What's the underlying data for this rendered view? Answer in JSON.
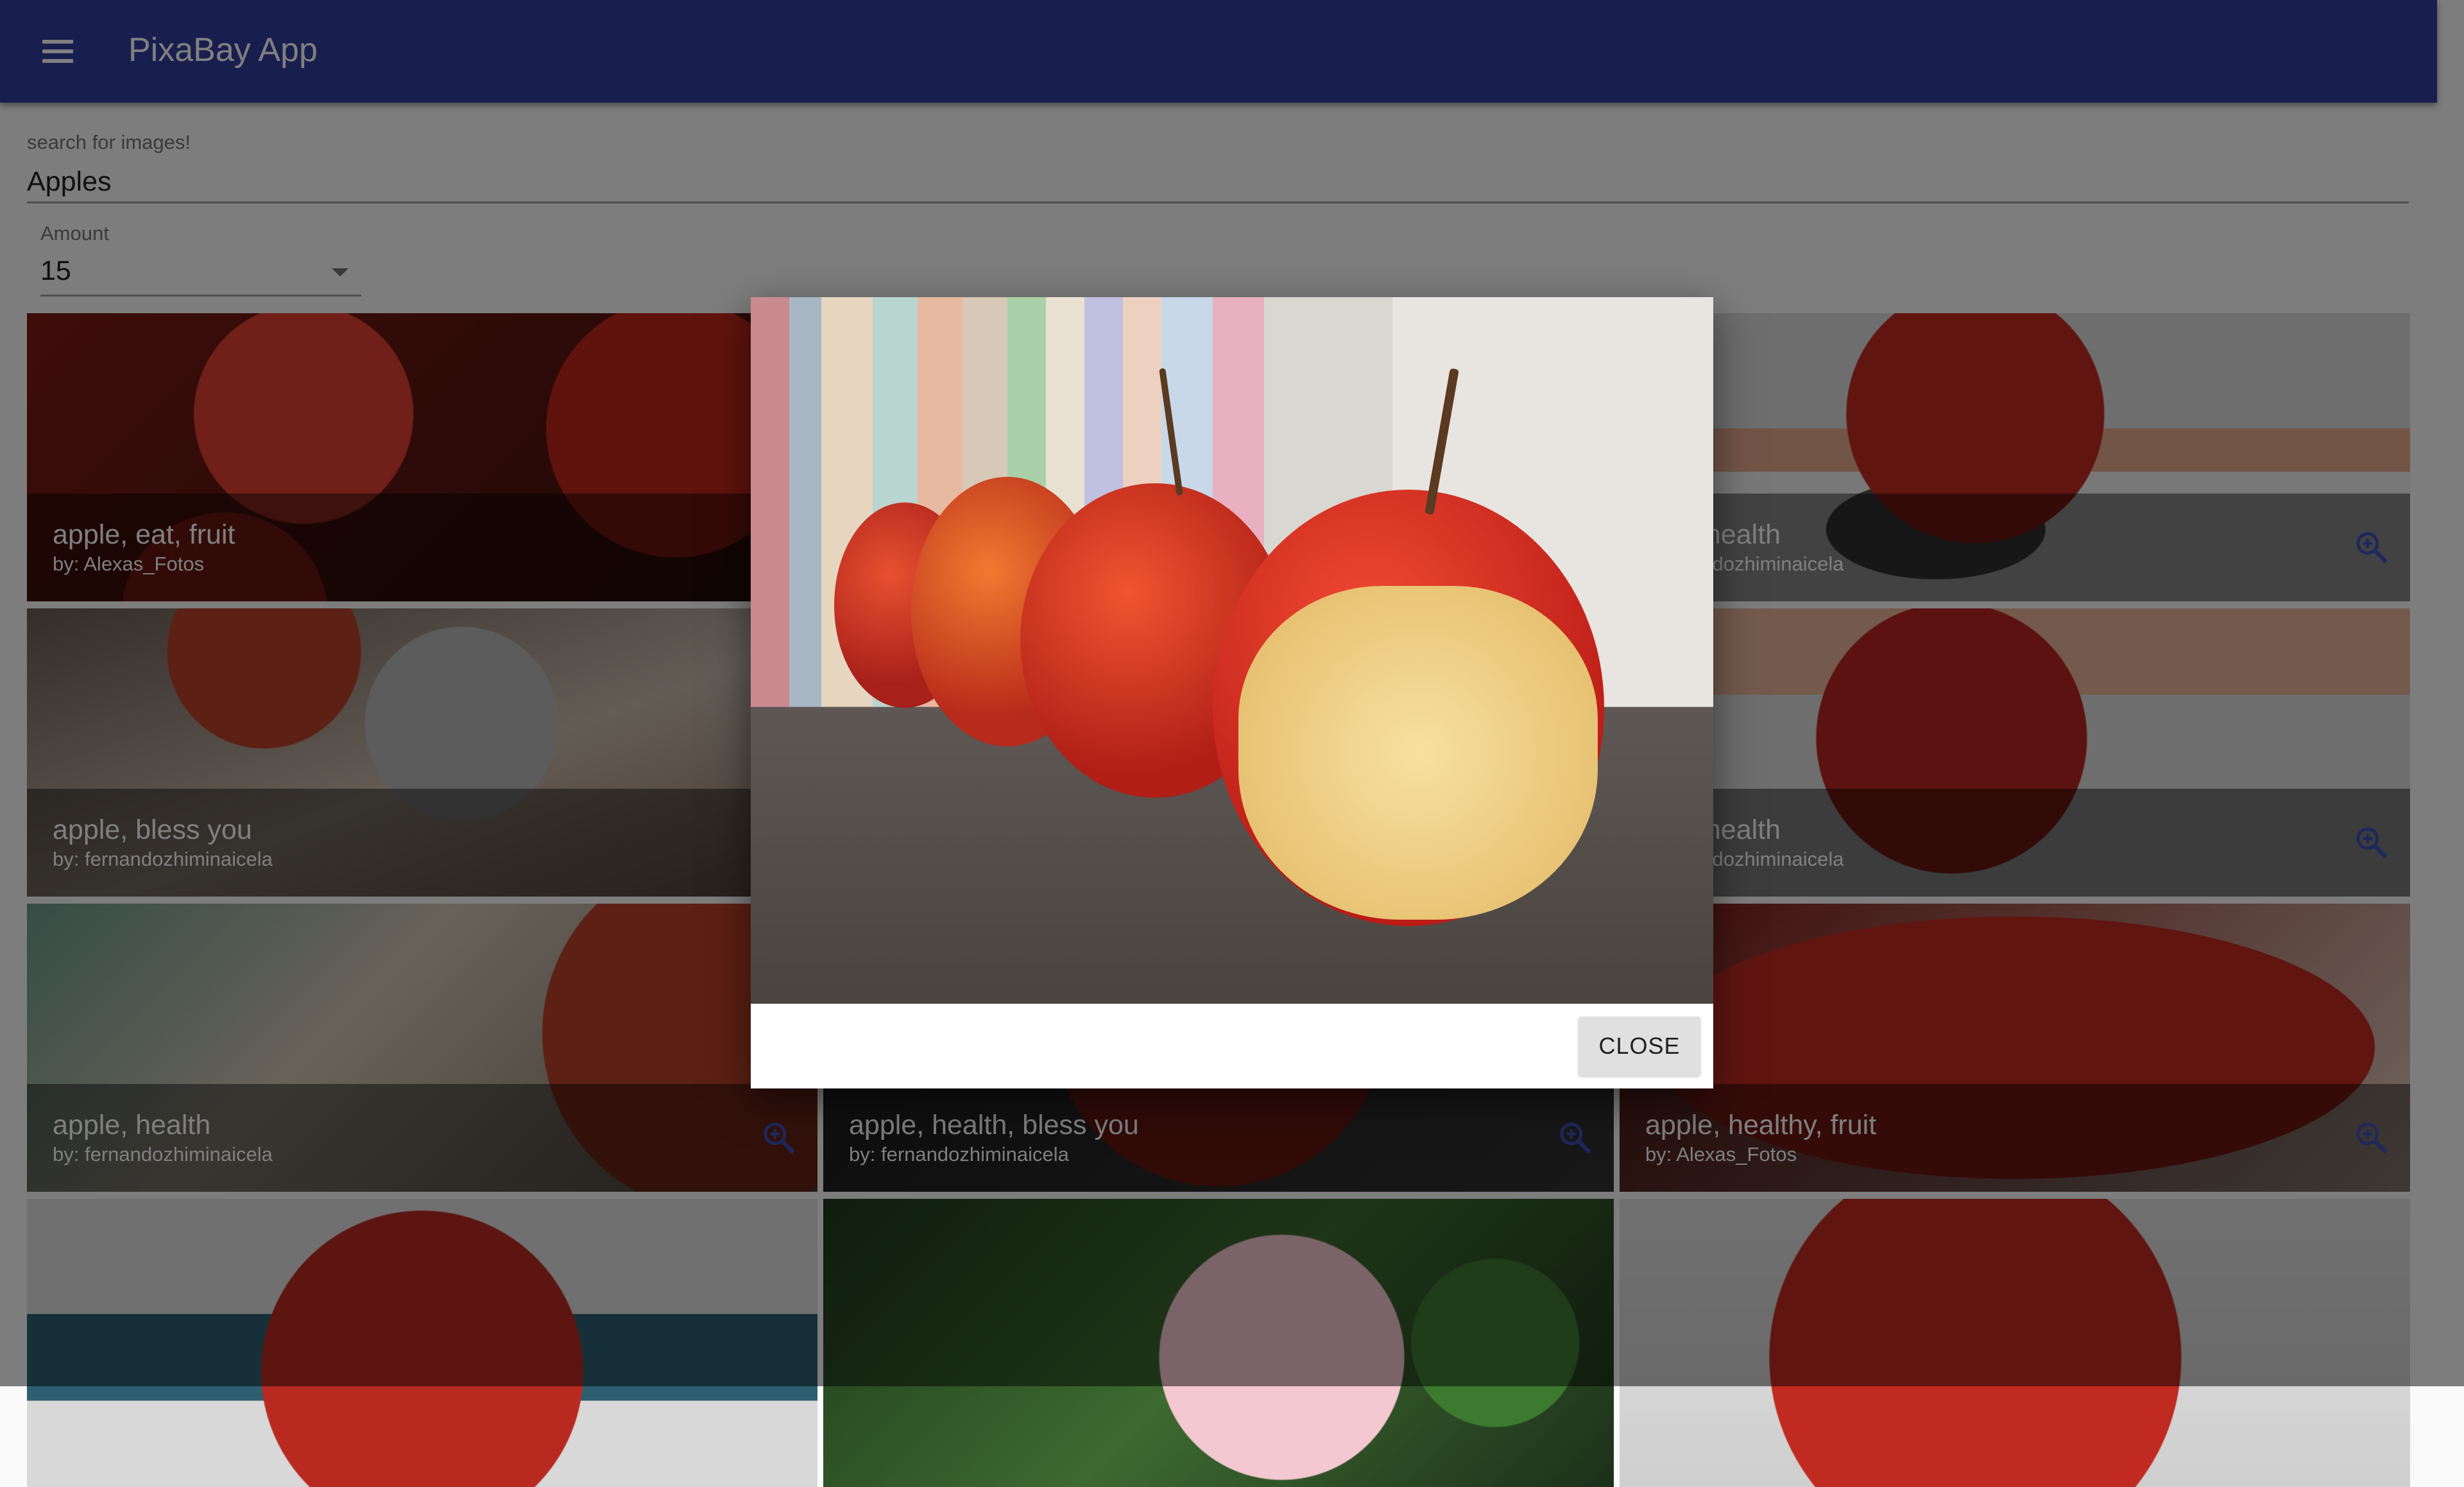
{
  "header": {
    "title": "PixaBay App",
    "menu_icon": "menu-icon"
  },
  "search": {
    "label": "search for images!",
    "value": "Apples"
  },
  "amount": {
    "label": "Amount",
    "value": "15"
  },
  "colors": {
    "appbar": "#303f9f",
    "accent": "#3f51b5"
  },
  "results": [
    {
      "title": "apple, eat, fruit",
      "author": "by: Alexas_Fotos"
    },
    {
      "title": "",
      "author": ""
    },
    {
      "title": ", health",
      "author": "andozhiminaicela"
    },
    {
      "title": "apple, bless you",
      "author": "by: fernandozhiminaicela"
    },
    {
      "title": "",
      "author": ""
    },
    {
      "title": ", health",
      "author": "andozhiminaicela"
    },
    {
      "title": "apple, health",
      "author": "by: fernandozhiminaicela"
    },
    {
      "title": "apple, health, bless you",
      "author": "by: fernandozhiminaicela"
    },
    {
      "title": "apple, healthy, fruit",
      "author": "by: Alexas_Fotos"
    }
  ],
  "dialog": {
    "close_label": "CLOSE"
  }
}
